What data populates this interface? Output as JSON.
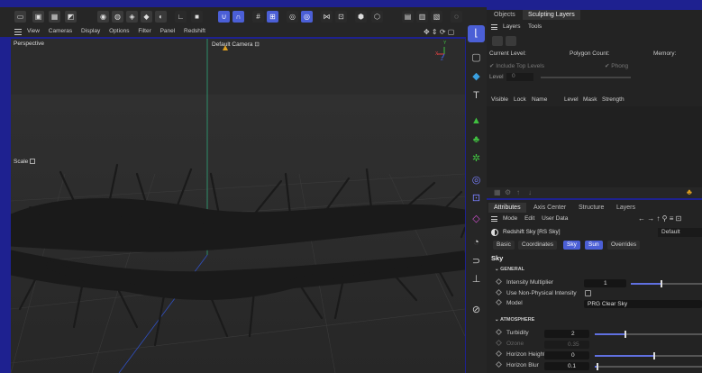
{
  "toolbar": {
    "icons": [
      "display-icon",
      "camera-icon",
      "film-icon",
      "render-icon",
      "circle-icon",
      "sphere-icon",
      "cube-icon",
      "deform-icon",
      "sculpt-icon",
      "axis-icon",
      "square-icon",
      "magnet-icon",
      "magnet-alt-icon",
      "grid-icon",
      "grid-alt-icon",
      "light-icon",
      "light-alt-icon",
      "tag-icon",
      "tag-alt-icon",
      "hex-icon",
      "hex-alt-icon",
      "render-view-icon",
      "render-region-icon",
      "render-queue-icon",
      "preferences-icon"
    ]
  },
  "viewport": {
    "menu": [
      "View",
      "Cameras",
      "Display",
      "Options",
      "Filter",
      "Panel",
      "Redshift"
    ],
    "view_name": "Perspective",
    "camera_name": "Default Camera",
    "camera_suffix": "⊡",
    "scale_label": "Scale",
    "axis": {
      "y": "Y",
      "x": "X",
      "z": "Z"
    }
  },
  "left_tools": [
    "select-icon",
    "cube-icon",
    "text-icon",
    "spline-icon",
    "mograph-icon",
    "effector-icon",
    "deformer-icon",
    "field-icon",
    "scene-icon",
    "volume-icon",
    "light-icon",
    "camera-icon",
    "marker-icon",
    "pen-icon"
  ],
  "objects_panel": {
    "tabs": [
      "Objects",
      "Sculpting Layers"
    ],
    "active_tab": 1,
    "menu": [
      "Layers",
      "Tools"
    ],
    "current_level_label": "Current Level:",
    "polygon_count_label": "Polygon Count:",
    "memory_label": "Memory:",
    "include_top_levels": "Include Top Levels",
    "phong": "Phong",
    "level_label": "Level",
    "level_value": "0",
    "columns": [
      "Visible",
      "Lock",
      "Name",
      "Level",
      "Mask",
      "Strength"
    ]
  },
  "attributes_panel": {
    "tabs": [
      "Attributes",
      "Axis Center",
      "Structure",
      "Layers"
    ],
    "active_tab": 0,
    "menu": [
      "Mode",
      "Edit",
      "User Data"
    ],
    "object_name": "Redshift Sky [RS Sky]",
    "preset": "Default",
    "subtabs": [
      "Basic",
      "Coordinates",
      "Sky",
      "Sun",
      "Overrides"
    ],
    "active_subtabs": [
      2,
      3
    ],
    "section_title": "Sky",
    "general": {
      "header": "GENERAL",
      "intensity_label": "Intensity Multiplier",
      "intensity_value": "1",
      "intensity_level": 0.42,
      "non_physical_label": "Use Non-Physical Intensity",
      "model_label": "Model",
      "model_value": "PRG Clear Sky"
    },
    "atmosphere": {
      "header": "ATMOSPHERE",
      "turbidity_label": "Turbidity",
      "turbidity_value": "2",
      "turbidity_level": 0.28,
      "ozone_label": "Ozone",
      "ozone_value": "0.35",
      "horizon_height_label": "Horizon Height",
      "horizon_height_value": "0",
      "horizon_height_level": 0.55,
      "horizon_blur_label": "Horizon Blur",
      "horizon_blur_value": "0.1",
      "horizon_blur_level": 0.02
    }
  },
  "colors": {
    "desktop": "#1e2190",
    "panel": "#232323",
    "accent": "#4b5fd6"
  }
}
